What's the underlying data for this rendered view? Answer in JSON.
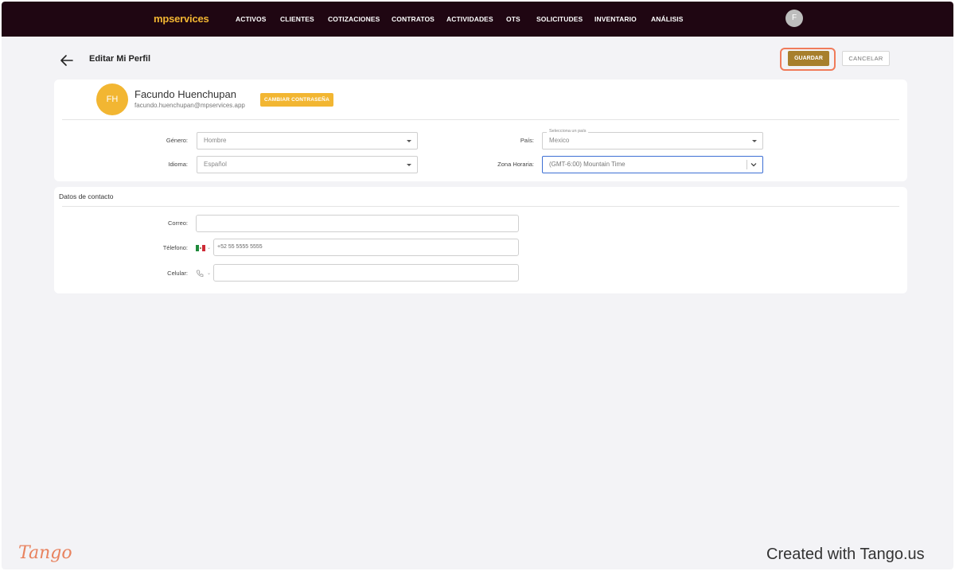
{
  "nav": {
    "brand_prefix": "mp",
    "brand_suffix": "services",
    "items": [
      "ACTIVOS",
      "CLIENTES",
      "COTIZACIONES",
      "CONTRATOS",
      "ACTIVIDADES",
      "OTS",
      "SOLICITUDES",
      "INVENTARIO",
      "ANÁLISIS"
    ],
    "avatar_initial": "F"
  },
  "header": {
    "title": "Editar Mi Perfil",
    "save_label": "GUARDAR",
    "cancel_label": "CANCELAR"
  },
  "profile": {
    "initials": "FH",
    "name": "Facundo Huenchupan",
    "email": "facundo.huenchupan@mpservices.app",
    "change_password_label": "CAMBIAR CONTRASEÑA",
    "fields": {
      "genero": {
        "label": "Género:",
        "value": "Hombre"
      },
      "idioma": {
        "label": "Idioma:",
        "value": "Español"
      },
      "pais": {
        "label": "País:",
        "value": "Mexico",
        "floating_label": "Selecciona un país"
      },
      "zona": {
        "label": "Zona Horaria:",
        "value": "(GMT-6:00) Mountain Time"
      }
    }
  },
  "contact": {
    "title": "Datos de contacto",
    "correo": {
      "label": "Correo:",
      "value": ""
    },
    "telefono": {
      "label": "Télefono:",
      "placeholder": "+52 55 5555 5555"
    },
    "celular": {
      "label": "Celular:",
      "value": ""
    }
  },
  "footer": {
    "logo_text": "Tango",
    "credit": "Created with Tango.us"
  },
  "colors": {
    "nav_bg": "#1f0612",
    "brand": "#f2b632",
    "save_button": "#a77f2c",
    "highlight_ring": "#f07b5a",
    "focus_border": "#3d6fd4",
    "tango": "#e8825e"
  }
}
